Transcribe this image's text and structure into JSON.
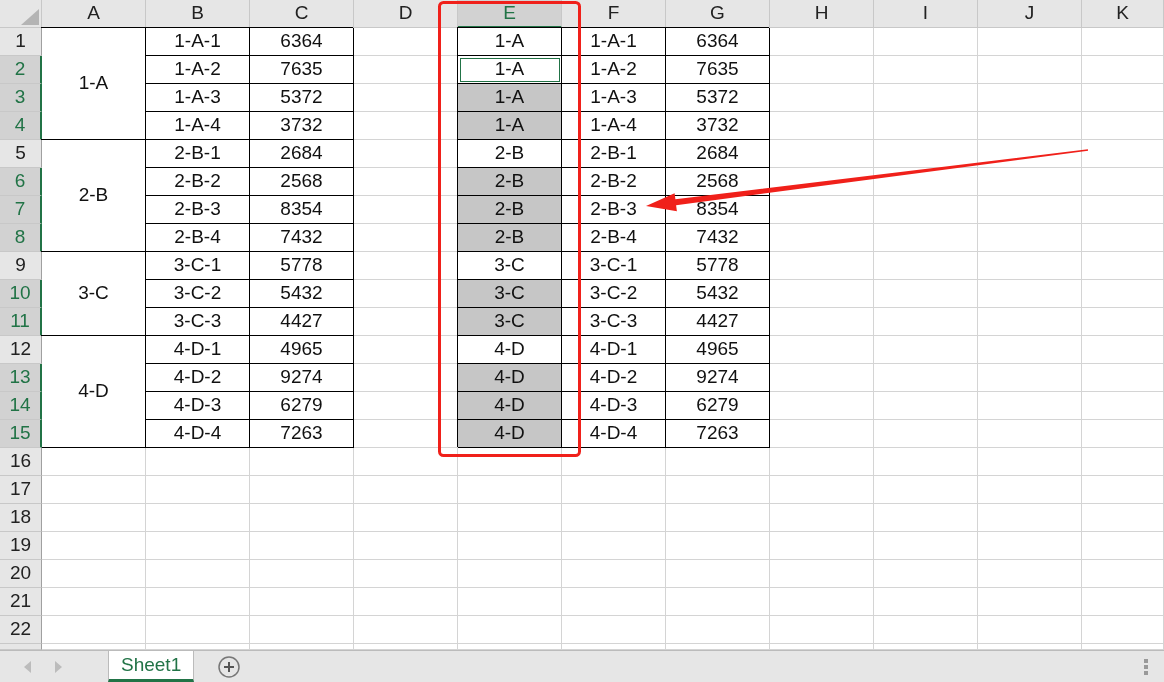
{
  "columns": [
    {
      "label": "A",
      "selected": false
    },
    {
      "label": "B",
      "selected": false
    },
    {
      "label": "C",
      "selected": false
    },
    {
      "label": "D",
      "selected": false
    },
    {
      "label": "E",
      "selected": true
    },
    {
      "label": "F",
      "selected": false
    },
    {
      "label": "G",
      "selected": false
    },
    {
      "label": "H",
      "selected": false
    },
    {
      "label": "I",
      "selected": false
    },
    {
      "label": "J",
      "selected": false
    },
    {
      "label": "K",
      "selected": false
    }
  ],
  "groups": [
    {
      "label": "1-A",
      "rows": [
        {
          "number": "1",
          "selected": false,
          "active": false,
          "b": "1-A-1",
          "c": "6364",
          "e": "1-A",
          "f": "1-A-1",
          "g": "6364"
        },
        {
          "number": "2",
          "selected": true,
          "active": true,
          "b": "1-A-2",
          "c": "7635",
          "e": "1-A",
          "f": "1-A-2",
          "g": "7635"
        },
        {
          "number": "3",
          "selected": true,
          "active": false,
          "b": "1-A-3",
          "c": "5372",
          "e": "1-A",
          "f": "1-A-3",
          "g": "5372"
        },
        {
          "number": "4",
          "selected": true,
          "active": false,
          "b": "1-A-4",
          "c": "3732",
          "e": "1-A",
          "f": "1-A-4",
          "g": "3732"
        }
      ]
    },
    {
      "label": "2-B",
      "rows": [
        {
          "number": "5",
          "selected": false,
          "active": false,
          "b": "2-B-1",
          "c": "2684",
          "e": "2-B",
          "f": "2-B-1",
          "g": "2684"
        },
        {
          "number": "6",
          "selected": true,
          "active": false,
          "b": "2-B-2",
          "c": "2568",
          "e": "2-B",
          "f": "2-B-2",
          "g": "2568"
        },
        {
          "number": "7",
          "selected": true,
          "active": false,
          "b": "2-B-3",
          "c": "8354",
          "e": "2-B",
          "f": "2-B-3",
          "g": "8354"
        },
        {
          "number": "8",
          "selected": true,
          "active": false,
          "b": "2-B-4",
          "c": "7432",
          "e": "2-B",
          "f": "2-B-4",
          "g": "7432"
        }
      ]
    },
    {
      "label": "3-C",
      "rows": [
        {
          "number": "9",
          "selected": false,
          "active": false,
          "b": "3-C-1",
          "c": "5778",
          "e": "3-C",
          "f": "3-C-1",
          "g": "5778"
        },
        {
          "number": "10",
          "selected": true,
          "active": false,
          "b": "3-C-2",
          "c": "5432",
          "e": "3-C",
          "f": "3-C-2",
          "g": "5432"
        },
        {
          "number": "11",
          "selected": true,
          "active": false,
          "b": "3-C-3",
          "c": "4427",
          "e": "3-C",
          "f": "3-C-3",
          "g": "4427"
        }
      ]
    },
    {
      "label": "4-D",
      "rows": [
        {
          "number": "12",
          "selected": false,
          "active": false,
          "b": "4-D-1",
          "c": "4965",
          "e": "4-D",
          "f": "4-D-1",
          "g": "4965"
        },
        {
          "number": "13",
          "selected": true,
          "active": false,
          "b": "4-D-2",
          "c": "9274",
          "e": "4-D",
          "f": "4-D-2",
          "g": "9274"
        },
        {
          "number": "14",
          "selected": true,
          "active": false,
          "b": "4-D-3",
          "c": "6279",
          "e": "4-D",
          "f": "4-D-3",
          "g": "6279"
        },
        {
          "number": "15",
          "selected": true,
          "active": false,
          "b": "4-D-4",
          "c": "7263",
          "e": "4-D",
          "f": "4-D-4",
          "g": "7263"
        }
      ]
    }
  ],
  "empty_rows": [
    "16",
    "17",
    "18",
    "19",
    "20",
    "21",
    "22"
  ],
  "sheet_tabs": [
    {
      "label": "Sheet1",
      "selected": true
    }
  ],
  "annotations": {
    "highlight_box": true,
    "arrow": true
  }
}
